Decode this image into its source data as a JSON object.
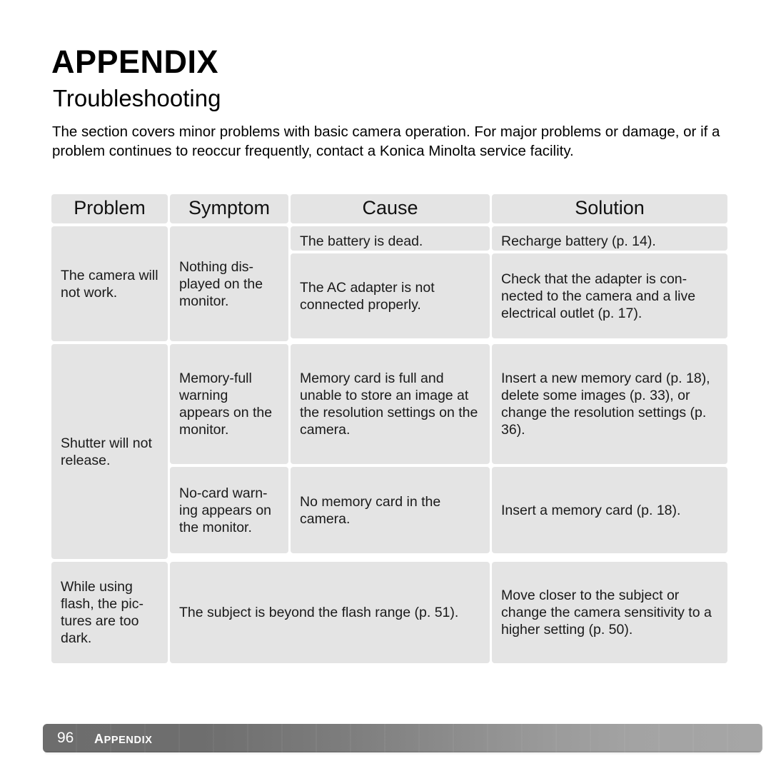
{
  "document": {
    "chapter_title": "APPENDIX",
    "section_title": "Troubleshooting",
    "intro": "The section covers minor problems with basic camera operation. For major problems or damage, or if a problem continues to reoccur frequently, contact a Konica Minolta service facility."
  },
  "table": {
    "headers": {
      "problem": "Problem",
      "symptom": "Symptom",
      "cause": "Cause",
      "solution": "Solution"
    },
    "rows": [
      {
        "problem": "The camera will not work.",
        "symptom": "Nothing dis-played on the monitor.",
        "entries": [
          {
            "cause": "The battery is dead.",
            "solution": "Recharge battery (p. 14)."
          },
          {
            "cause": "The AC adapter is not connected properly.",
            "solution": "Check that the adapter is con-nected to the camera and a live electrical outlet (p. 17)."
          }
        ]
      },
      {
        "problem": "Shutter will not release.",
        "entries": [
          {
            "symptom": "Memory-full warning appears on the monitor.",
            "cause": "Memory card is full and unable to store an image at the resolution settings on the camera.",
            "solution": "Insert a new memory card (p. 18), delete some images (p. 33), or change the resolution settings (p. 36)."
          },
          {
            "symptom": "No-card warn-ing appears on the monitor.",
            "cause": "No memory card in the camera.",
            "solution": "Insert a memory card (p. 18)."
          }
        ]
      },
      {
        "problem": "While using flash, the pic-tures are too dark.",
        "cause_wide": "The subject is beyond the flash range (p. 51).",
        "solution": "Move closer to the subject or change the camera sensitivity to a higher setting (p. 50)."
      }
    ]
  },
  "footer": {
    "page_number": "96",
    "label_first": "A",
    "label_rest": "PPENDIX",
    "colors": {
      "bar_start": "#6d6d6d",
      "bar_end": "#a6a6a6",
      "text": "#ffffff"
    }
  },
  "colors": {
    "cell_background": "#e4e4e4",
    "page_background": "#ffffff",
    "text": "#000000"
  }
}
